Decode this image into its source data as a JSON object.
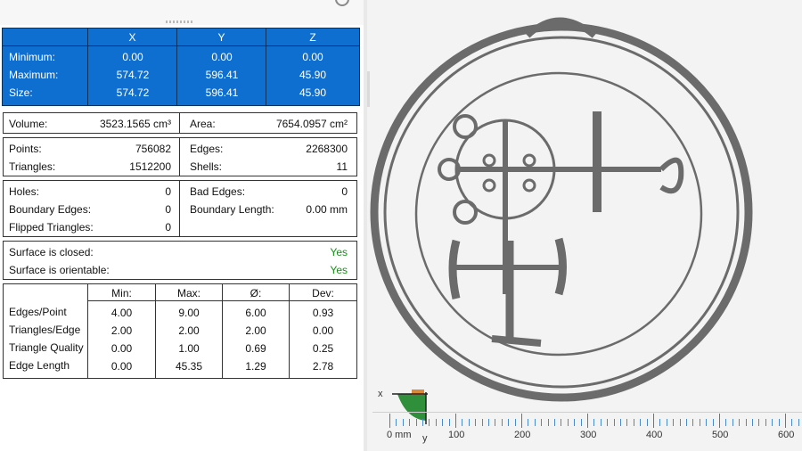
{
  "bounds": {
    "headers": [
      "X",
      "Y",
      "Z"
    ],
    "rows": [
      {
        "label": "Minimum:",
        "values": [
          "0.00",
          "0.00",
          "0.00"
        ]
      },
      {
        "label": "Maximum:",
        "values": [
          "574.72",
          "596.41",
          "45.90"
        ]
      },
      {
        "label": "Size:",
        "values": [
          "574.72",
          "596.41",
          "45.90"
        ]
      }
    ]
  },
  "volume": {
    "label": "Volume:",
    "value": "3523.1565 cm³",
    "area_label": "Area:",
    "area_value": "7654.0957 cm²"
  },
  "counts": {
    "points_label": "Points:",
    "points": "756082",
    "triangles_label": "Triangles:",
    "triangles": "1512200",
    "edges_label": "Edges:",
    "edges": "2268300",
    "shells_label": "Shells:",
    "shells": "11"
  },
  "errors": {
    "holes_label": "Holes:",
    "holes": "0",
    "boundary_edges_label": "Boundary Edges:",
    "boundary_edges": "0",
    "flipped_label": "Flipped Triangles:",
    "flipped": "0",
    "bad_edges_label": "Bad Edges:",
    "bad_edges": "0",
    "boundary_length_label": "Boundary Length:",
    "boundary_length": "0.00 mm"
  },
  "surface": {
    "closed_label": "Surface is closed:",
    "closed": "Yes",
    "orientable_label": "Surface is orientable:",
    "orientable": "Yes"
  },
  "stats": {
    "headers": [
      "Min:",
      "Max:",
      "Ø:",
      "Dev:"
    ],
    "rows": [
      {
        "label": "Edges/Point",
        "values": [
          "4.00",
          "9.00",
          "6.00",
          "0.93"
        ]
      },
      {
        "label": "Triangles/Edge",
        "values": [
          "2.00",
          "2.00",
          "2.00",
          "0.00"
        ]
      },
      {
        "label": "Triangle Quality",
        "values": [
          "0.00",
          "1.00",
          "0.69",
          "0.25"
        ]
      },
      {
        "label": "Edge Length",
        "values": [
          "0.00",
          "45.35",
          "1.29",
          "2.78"
        ]
      }
    ]
  },
  "viewport": {
    "axis_x": "x",
    "axis_y": "y",
    "ruler_labels": [
      "0 mm",
      "100",
      "200",
      "300",
      "400",
      "500",
      "600"
    ]
  },
  "colors": {
    "selection_blue": "#0f6fd0",
    "yes_green": "#1a8f1a",
    "model_gray": "#6b6b6b",
    "ruler_blue": "#4a8acb"
  }
}
